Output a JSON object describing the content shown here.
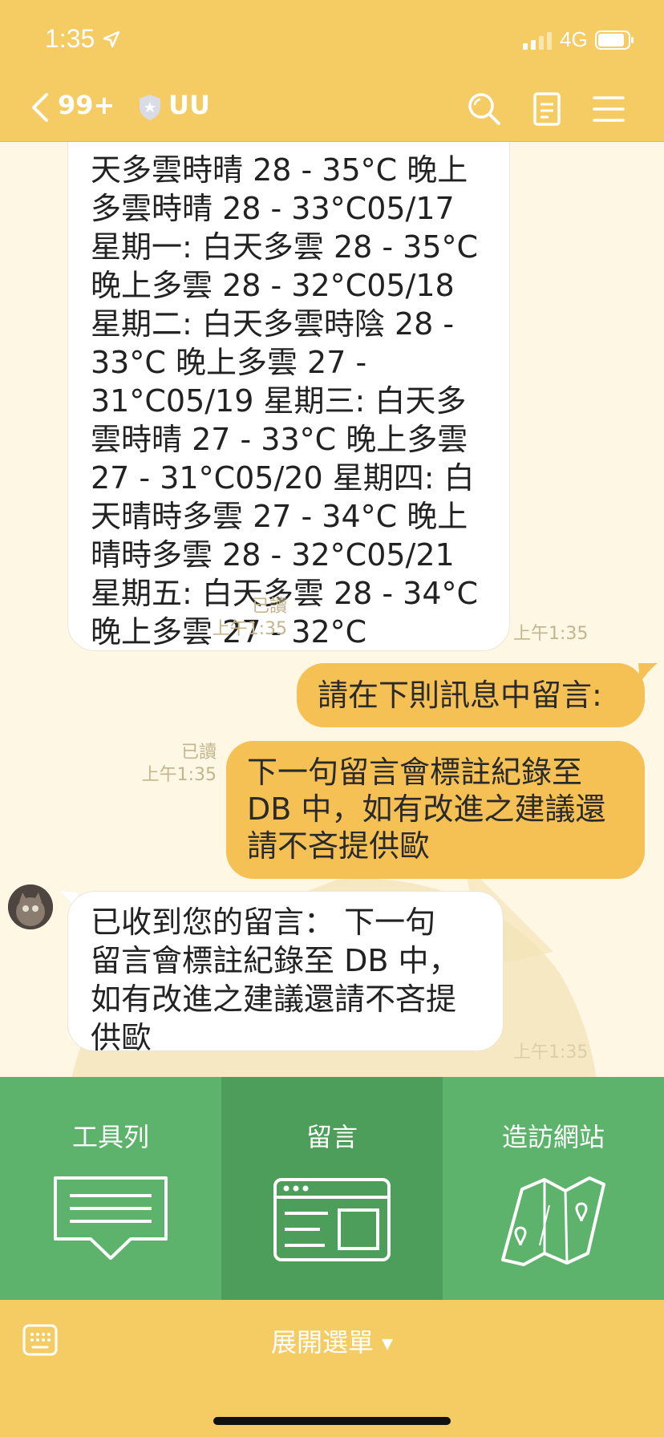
{
  "status": {
    "time": "1:35",
    "network": "4G"
  },
  "nav": {
    "back_count": "99+",
    "room": "UU"
  },
  "messages": {
    "weather_lines": [
      "天多雲時晴 28 - 35°C 晚上",
      "多雲時晴 28 - 33°C05/17",
      "星期一: 白天多雲 28 - 35°C",
      "晚上多雲 28 - 32°C05/18",
      "星期二: 白天多雲時陰 28 -",
      "33°C 晚上多雲 27 -",
      "31°C05/19 星期三: 白天多",
      "雲時晴 27 - 33°C 晚上多雲",
      "27 - 31°C05/20 星期四: 白",
      "天晴時多雲 27 - 34°C 晚上",
      "晴時多雲 28 - 32°C05/21",
      "星期五: 白天多雲 28 - 34°C",
      "晚上多雲 27 - 32°C"
    ],
    "weather_time": "上午1:35",
    "sent1_text": "請在下則訊息中留言:",
    "sent1_read": "已讀",
    "sent1_time": "上午1:35",
    "sent2_lines": [
      "下一句留言會標註紀錄至",
      "DB 中，如有改進之建議還",
      "請不吝提供歐"
    ],
    "sent2_read": "已讀",
    "sent2_time": "上午1:35",
    "reply_lines": [
      "已收到您的留言： 下一句",
      "留言會標註紀錄至 DB 中，",
      "如有改進之建議還請不吝提",
      "供歐"
    ],
    "reply_time": "上午1:35"
  },
  "menu": {
    "items": [
      {
        "label": "工具列",
        "icon": "toolbar-icon"
      },
      {
        "label": "留言",
        "icon": "browser-window-icon"
      },
      {
        "label": "造訪網站",
        "icon": "map-icon"
      }
    ]
  },
  "bottom": {
    "expand_label": "展開選單"
  },
  "colors": {
    "brand_yellow": "#f5cc63",
    "menu_green": "#5db26c",
    "bubble_yellow": "#f5c155"
  }
}
